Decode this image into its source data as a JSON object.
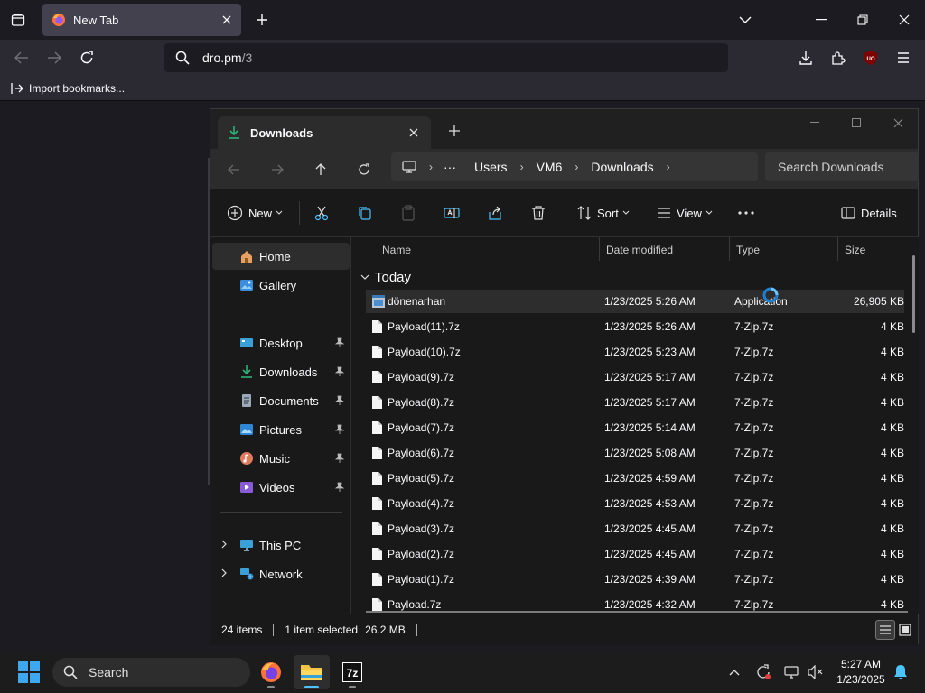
{
  "browser": {
    "tab_title": "New Tab",
    "url_host": "dro.pm",
    "url_path": "/3",
    "bookmarks_item": "Import bookmarks...",
    "ext_badge": "UO"
  },
  "explorer": {
    "tab_title": "Downloads",
    "breadcrumb": [
      "Users",
      "VM6",
      "Downloads"
    ],
    "search_placeholder": "Search Downloads",
    "commands": {
      "new": "New",
      "sort": "Sort",
      "view": "View",
      "details": "Details"
    },
    "nav": [
      {
        "label": "Home"
      },
      {
        "label": "Gallery"
      },
      {
        "label": "Desktop"
      },
      {
        "label": "Downloads"
      },
      {
        "label": "Documents"
      },
      {
        "label": "Pictures"
      },
      {
        "label": "Music"
      },
      {
        "label": "Videos"
      },
      {
        "label": "This PC"
      },
      {
        "label": "Network"
      }
    ],
    "columns": {
      "name": "Name",
      "date": "Date modified",
      "type": "Type",
      "size": "Size"
    },
    "group": "Today",
    "files": [
      {
        "name": "dönenarhan",
        "date": "1/23/2025 5:26 AM",
        "type": "Application",
        "size": "26,905 KB"
      },
      {
        "name": "Payload(11).7z",
        "date": "1/23/2025 5:26 AM",
        "type": "7-Zip.7z",
        "size": "4 KB"
      },
      {
        "name": "Payload(10).7z",
        "date": "1/23/2025 5:23 AM",
        "type": "7-Zip.7z",
        "size": "4 KB"
      },
      {
        "name": "Payload(9).7z",
        "date": "1/23/2025 5:17 AM",
        "type": "7-Zip.7z",
        "size": "4 KB"
      },
      {
        "name": "Payload(8).7z",
        "date": "1/23/2025 5:17 AM",
        "type": "7-Zip.7z",
        "size": "4 KB"
      },
      {
        "name": "Payload(7).7z",
        "date": "1/23/2025 5:14 AM",
        "type": "7-Zip.7z",
        "size": "4 KB"
      },
      {
        "name": "Payload(6).7z",
        "date": "1/23/2025 5:08 AM",
        "type": "7-Zip.7z",
        "size": "4 KB"
      },
      {
        "name": "Payload(5).7z",
        "date": "1/23/2025 4:59 AM",
        "type": "7-Zip.7z",
        "size": "4 KB"
      },
      {
        "name": "Payload(4).7z",
        "date": "1/23/2025 4:53 AM",
        "type": "7-Zip.7z",
        "size": "4 KB"
      },
      {
        "name": "Payload(3).7z",
        "date": "1/23/2025 4:45 AM",
        "type": "7-Zip.7z",
        "size": "4 KB"
      },
      {
        "name": "Payload(2).7z",
        "date": "1/23/2025 4:45 AM",
        "type": "7-Zip.7z",
        "size": "4 KB"
      },
      {
        "name": "Payload(1).7z",
        "date": "1/23/2025 4:39 AM",
        "type": "7-Zip.7z",
        "size": "4 KB"
      },
      {
        "name": "Payload.7z",
        "date": "1/23/2025 4:32 AM",
        "type": "7-Zip.7z",
        "size": "4 KB"
      }
    ],
    "status": {
      "count": "24 items",
      "selected": "1 item selected",
      "size": "26.2 MB"
    }
  },
  "taskbar": {
    "search_label": "Search",
    "time": "5:27 AM",
    "date": "1/23/2025"
  },
  "colors": {
    "accent": "#4cc2ff",
    "explorer_bg": "#191919",
    "firefox_bg": "#1c1b22"
  }
}
